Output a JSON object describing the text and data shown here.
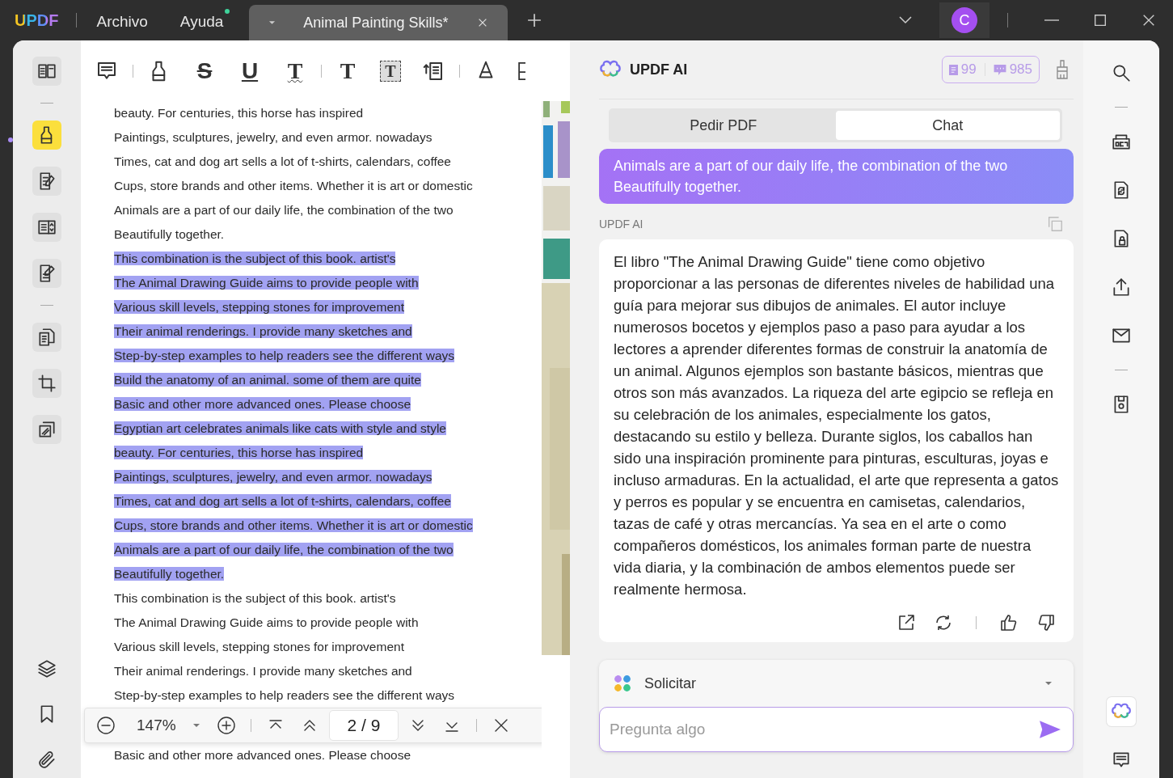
{
  "title_bar": {
    "logo": "UPDF",
    "menus": [
      {
        "label": "Archivo",
        "notification": false
      },
      {
        "label": "Ayuda",
        "notification": true
      }
    ],
    "tab": {
      "title": "Animal Painting Skills*"
    },
    "avatar": "C"
  },
  "left_sidebar": {
    "tools": [
      {
        "kind": "reader",
        "selected": false
      },
      {
        "kind": "separator"
      },
      {
        "kind": "highlight",
        "selected": true
      },
      {
        "kind": "edit",
        "selected": false
      },
      {
        "kind": "form",
        "selected": false
      },
      {
        "kind": "sign",
        "selected": false
      },
      {
        "kind": "separator"
      },
      {
        "kind": "organize",
        "selected": false
      },
      {
        "kind": "crop",
        "selected": false
      },
      {
        "kind": "compress",
        "selected": false
      }
    ],
    "bottom": [
      {
        "kind": "layers"
      },
      {
        "kind": "bookmark"
      },
      {
        "kind": "attachment"
      }
    ]
  },
  "toolbar": {
    "tools": [
      {
        "kind": "comment"
      },
      {
        "kind": "separator"
      },
      {
        "kind": "highlight"
      },
      {
        "kind": "strike",
        "glyph": "S"
      },
      {
        "kind": "underline",
        "glyph": "U"
      },
      {
        "kind": "squiggly",
        "glyph": "T"
      },
      {
        "kind": "separator"
      },
      {
        "kind": "text",
        "glyph": "T"
      },
      {
        "kind": "textbox",
        "glyph": "T"
      },
      {
        "kind": "callout"
      },
      {
        "kind": "separator"
      },
      {
        "kind": "pencil"
      },
      {
        "kind": "eraser"
      }
    ]
  },
  "document": {
    "lines": [
      {
        "text": "beauty. For centuries, this horse has inspired",
        "highlighted": false
      },
      {
        "text": "Paintings, sculptures, jewelry, and even armor. nowadays",
        "highlighted": false
      },
      {
        "text": "Times, cat and dog art sells a lot of t-shirts, calendars, coffee",
        "highlighted": false
      },
      {
        "text": "Cups, store brands and other items. Whether it is art or domestic",
        "highlighted": false
      },
      {
        "text": "Animals are a part of our daily life, the combination of the two",
        "highlighted": false
      },
      {
        "text": "Beautifully together.",
        "highlighted": false
      },
      {
        "text": "This combination is the subject of this book. artist's",
        "highlighted": true
      },
      {
        "text": "The Animal Drawing Guide aims to provide people with",
        "highlighted": true
      },
      {
        "text": "Various skill levels, stepping stones for improvement",
        "highlighted": true
      },
      {
        "text": "Their animal renderings. I provide many sketches and",
        "highlighted": true
      },
      {
        "text": "Step-by-step examples to help readers see the different ways",
        "highlighted": true
      },
      {
        "text": "Build the anatomy of an animal. some of them are quite",
        "highlighted": true
      },
      {
        "text": "Basic and other more advanced ones. Please choose",
        "highlighted": true
      },
      {
        "text": "Egyptian art celebrates animals like cats with style and style",
        "highlighted": true
      },
      {
        "text": "beauty. For centuries, this horse has inspired",
        "highlighted": true
      },
      {
        "text": "Paintings, sculptures, jewelry, and even armor. nowadays",
        "highlighted": true
      },
      {
        "text": "Times, cat and dog art sells a lot of t-shirts, calendars, coffee",
        "highlighted": true
      },
      {
        "text": "Cups, store brands and other items. Whether it is art or domestic",
        "highlighted": true
      },
      {
        "text": "Animals are a part of our daily life, the combination of the two",
        "highlighted": true
      },
      {
        "text": "Beautifully together.",
        "highlighted": true
      },
      {
        "text": "This combination is the subject of this book. artist's",
        "highlighted": false
      },
      {
        "text": "The Animal Drawing Guide aims to provide people with",
        "highlighted": false
      },
      {
        "text": "Various skill levels, stepping stones for improvement",
        "highlighted": false
      },
      {
        "text": "Their animal renderings. I provide many sketches and",
        "highlighted": false
      },
      {
        "text": "Step-by-step examples to help readers see the different ways",
        "highlighted": false
      }
    ],
    "page_toolbar": {
      "zoom": "147%",
      "page": "2 / 9"
    },
    "lines_below": [
      {
        "text": "Basic and other more advanced ones. Please choose",
        "highlighted": false
      }
    ]
  },
  "ai_panel": {
    "title": "UPDF AI",
    "credits": [
      {
        "kind": "pages",
        "count": "99"
      },
      {
        "kind": "chats",
        "count": "985"
      }
    ],
    "modes": [
      {
        "label": "Pedir PDF",
        "selected": false
      },
      {
        "label": "Chat",
        "selected": true
      }
    ],
    "user_message": [
      "Animals are a part of our daily life, the combination of the two",
      "Beautifully together."
    ],
    "reply_label": "UPDF AI",
    "reply": "El libro \"The Animal Drawing Guide\" tiene como objetivo proporcionar a las personas de diferentes niveles de habilidad una guía para mejorar sus dibujos de animales. El autor incluye numerosos bocetos y ejemplos paso a paso para ayudar a los lectores a aprender diferentes formas de construir la anatomía de un animal. Algunos ejemplos son bastante básicos, mientras que otros son más avanzados. La riqueza del arte egipcio se refleja en su celebración de los animales, especialmente los gatos, destacando su estilo y belleza. Durante siglos, los caballos han sido una inspiración prominente para pinturas, esculturas, joyas e incluso armaduras. En la actualidad, el arte que representa a gatos y perros es popular y se encuentra en camisetas, calendarios, tazas de café y otras mercancías. Ya sea en el arte o como compañeros domésticos, los animales forman parte de nuestra vida diaria, y la combinación de ambos elementos puede ser realmente hermosa.",
    "prompt": {
      "label": "Solicitar"
    },
    "input": {
      "placeholder": "Pregunta algo"
    }
  },
  "right_sidebar": {
    "tools": [
      {
        "kind": "search"
      },
      {
        "kind": "separator"
      },
      {
        "kind": "ocr"
      },
      {
        "kind": "convert"
      },
      {
        "kind": "protect"
      },
      {
        "kind": "share"
      },
      {
        "kind": "mail"
      },
      {
        "kind": "separator"
      },
      {
        "kind": "save"
      }
    ],
    "bottom": [
      {
        "kind": "ai",
        "selected": true
      },
      {
        "kind": "comment",
        "selected": false
      }
    ]
  }
}
